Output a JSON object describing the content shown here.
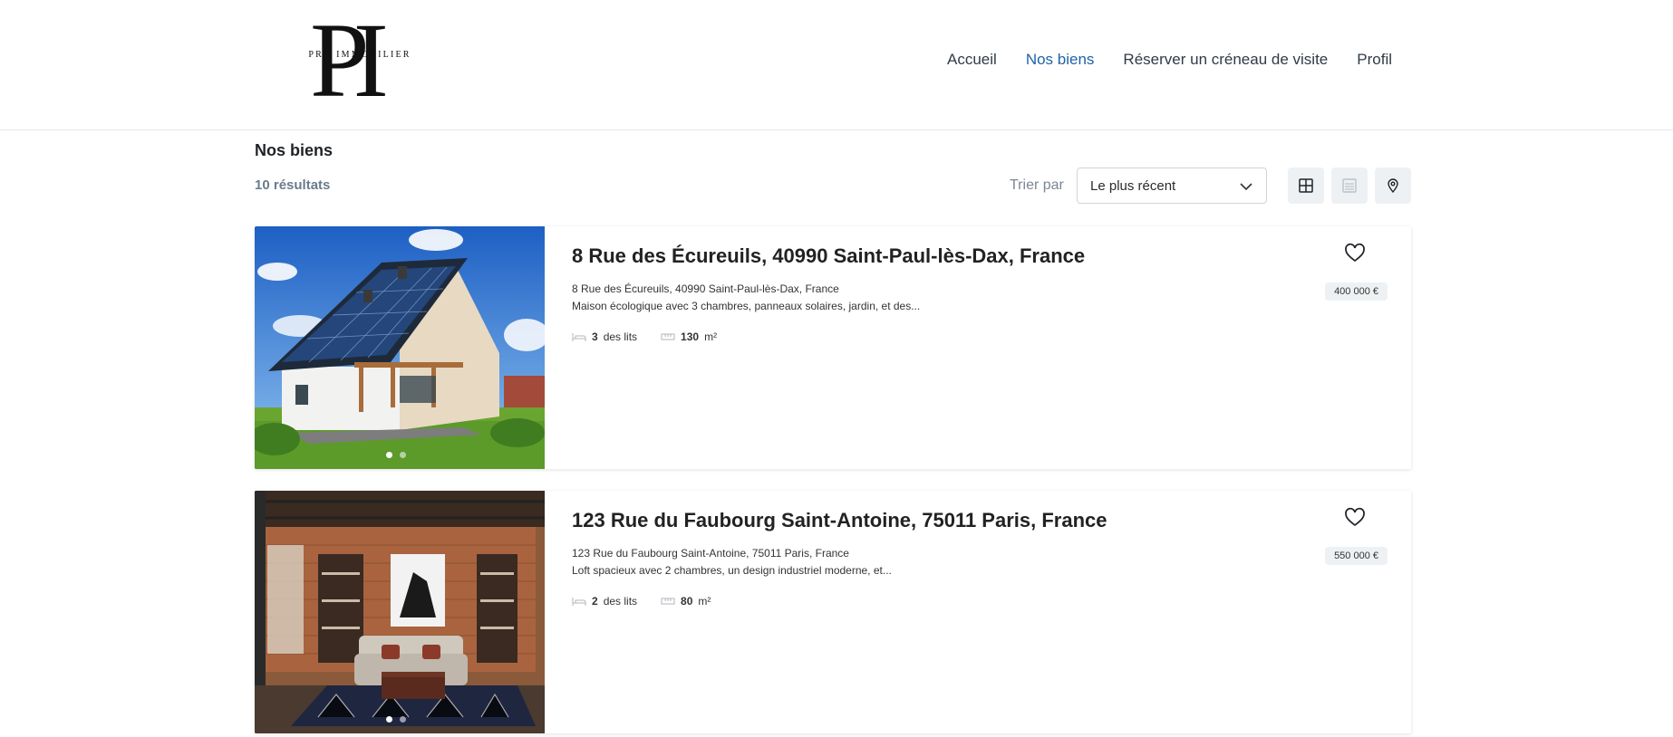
{
  "brand": {
    "monogram": "PI",
    "name": "PRO IMMOBILIER"
  },
  "nav": {
    "items": [
      {
        "label": "Accueil",
        "active": false
      },
      {
        "label": "Nos biens",
        "active": true
      },
      {
        "label": "Réserver un créneau de visite",
        "active": false
      },
      {
        "label": "Profil",
        "active": false
      }
    ]
  },
  "page": {
    "title": "Nos biens",
    "result_count": "10 résultats"
  },
  "sort": {
    "label": "Trier par",
    "selected": "Le plus récent"
  },
  "view_modes": [
    "grid-icon",
    "list-icon",
    "map-pin-icon"
  ],
  "colors": {
    "accent": "#1f63a8",
    "muted": "#6a7c8e",
    "chip_bg": "#eef1f4"
  },
  "listings": [
    {
      "title": "8 Rue des Écureuils, 40990 Saint-Paul-lès-Dax, France",
      "address": "8 Rue des Écureuils, 40990 Saint-Paul-lès-Dax, France",
      "description": "Maison écologique avec 3 chambres, panneaux solaires, jardin, et des...",
      "beds_value": "3",
      "beds_label": "des lits",
      "area_value": "130",
      "area_unit": "m²",
      "price": "400 000 €",
      "image": "house-with-solar-panels-photo"
    },
    {
      "title": "123 Rue du Faubourg Saint-Antoine, 75011 Paris, France",
      "address": "123 Rue du Faubourg Saint-Antoine, 75011 Paris, France",
      "description": "Loft spacieux avec 2 chambres, un design industriel moderne, et...",
      "beds_value": "2",
      "beds_label": "des lits",
      "area_value": "80",
      "area_unit": "m²",
      "price": "550 000 €",
      "image": "industrial-loft-interior-photo"
    }
  ]
}
